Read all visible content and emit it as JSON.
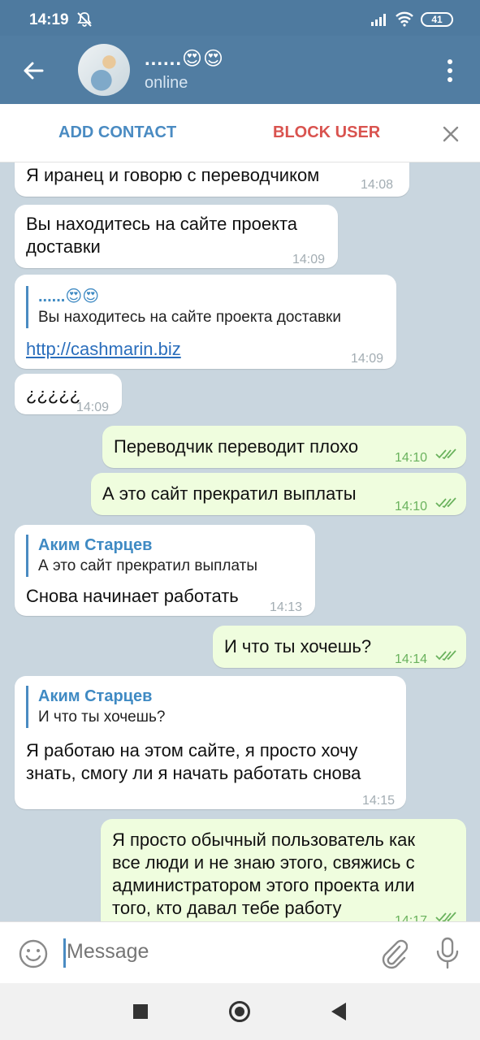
{
  "status_bar": {
    "time": "14:19",
    "battery": "41"
  },
  "header": {
    "name": "......😍😍",
    "status": "online"
  },
  "action_bar": {
    "add_contact": "ADD CONTACT",
    "block_user": "BLOCK USER"
  },
  "messages": [
    {
      "dir": "in",
      "text": "Я иранец и говорю с переводчиком",
      "time": "14:08"
    },
    {
      "dir": "in",
      "text": "Вы находитесь на сайте проекта\nдоставки",
      "time": "14:09"
    },
    {
      "dir": "in",
      "reply_name": "......😍😍",
      "reply_text": "Вы находитесь на сайте проекта доставки",
      "link": "http://cashmarin.biz",
      "time": "14:09"
    },
    {
      "dir": "in",
      "text": "¿¿¿¿¿",
      "time": "14:09"
    },
    {
      "dir": "out",
      "text": "Переводчик переводит плохо",
      "time": "14:10"
    },
    {
      "dir": "out",
      "text": "А это сайт прекратил выплаты",
      "time": "14:10"
    },
    {
      "dir": "in",
      "reply_name": "Аким Старцев",
      "reply_text": "А это сайт прекратил выплаты",
      "text": "Снова начинает работать",
      "time": "14:13"
    },
    {
      "dir": "out",
      "text": "И что ты хочешь?",
      "time": "14:14"
    },
    {
      "dir": "in",
      "reply_name": "Аким Старцев",
      "reply_text": "И что ты хочешь?",
      "text": "Я работаю на этом сайте, я просто хочу\nзнать, смогу ли я начать работать снова",
      "time": "14:15"
    },
    {
      "dir": "out",
      "text": "Я просто обычный пользователь как\nвсе люди и не знаю этого, свяжись с\nадминистратором этого проекта или\nтого, кто давал тебе работу",
      "time": "14:17"
    }
  ],
  "input": {
    "placeholder": "Message"
  },
  "colors": {
    "header": "#517da2",
    "chat_bg": "#c9d6df",
    "outgoing": "#effdde",
    "incoming": "#ffffff",
    "link": "#2a6ebc",
    "block": "#d9534f",
    "add": "#4a8bc2"
  }
}
